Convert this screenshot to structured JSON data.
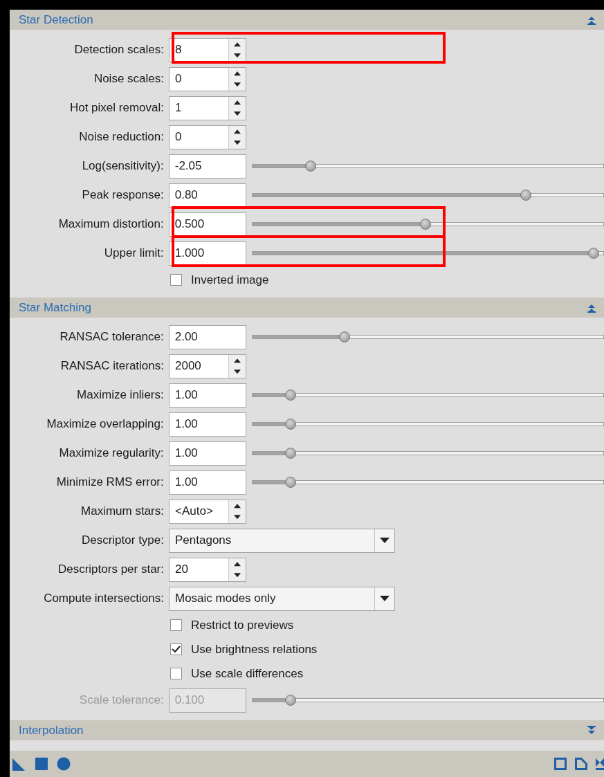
{
  "sections": [
    {
      "title": "Star Detection",
      "expanded": true,
      "rows": [
        {
          "kind": "spin",
          "label": "Detection scales:",
          "value": "8",
          "highlighted": true,
          "disabled": false
        },
        {
          "kind": "spin",
          "label": "Noise scales:",
          "value": "0",
          "highlighted": false,
          "disabled": false
        },
        {
          "kind": "spin",
          "label": "Hot pixel removal:",
          "value": "1",
          "highlighted": false,
          "disabled": false
        },
        {
          "kind": "spin",
          "label": "Noise reduction:",
          "value": "0",
          "highlighted": false,
          "disabled": false
        },
        {
          "kind": "slider",
          "label": "Log(sensitivity):",
          "value": "-2.05",
          "level": 0.16,
          "highlighted": false,
          "disabled": false
        },
        {
          "kind": "slider",
          "label": "Peak response:",
          "value": "0.80",
          "level": 0.8,
          "highlighted": false,
          "disabled": false
        },
        {
          "kind": "slider",
          "label": "Maximum distortion:",
          "value": "0.500",
          "level": 0.5,
          "highlighted": true,
          "disabled": false
        },
        {
          "kind": "slider",
          "label": "Upper limit:",
          "value": "1.000",
          "level": 1,
          "highlighted": true,
          "disabled": false
        },
        {
          "kind": "checkbox",
          "label": "Inverted image",
          "checked": false,
          "highlighted": false,
          "disabled": false
        }
      ]
    },
    {
      "title": "Star Matching",
      "expanded": true,
      "rows": [
        {
          "kind": "slider",
          "label": "RANSAC tolerance:",
          "value": "2.00",
          "level": 0.26,
          "highlighted": false,
          "disabled": false
        },
        {
          "kind": "spin",
          "label": "RANSAC iterations:",
          "value": "2000",
          "highlighted": false,
          "disabled": false
        },
        {
          "kind": "slider",
          "label": "Maximize inliers:",
          "value": "1.00",
          "level": 0.1,
          "highlighted": false,
          "disabled": false
        },
        {
          "kind": "slider",
          "label": "Maximize overlapping:",
          "value": "1.00",
          "level": 0.1,
          "highlighted": false,
          "disabled": false
        },
        {
          "kind": "slider",
          "label": "Maximize regularity:",
          "value": "1.00",
          "level": 0.1,
          "highlighted": false,
          "disabled": false
        },
        {
          "kind": "slider",
          "label": "Minimize RMS error:",
          "value": "1.00",
          "level": 0.1,
          "highlighted": false,
          "disabled": false
        },
        {
          "kind": "spin",
          "label": "Maximum stars:",
          "value": "<Auto>",
          "highlighted": false,
          "disabled": false
        },
        {
          "kind": "combo",
          "label": "Descriptor type:",
          "value": "Pentagons",
          "highlighted": false,
          "disabled": false
        },
        {
          "kind": "spin",
          "label": "Descriptors per star:",
          "value": "20",
          "highlighted": false,
          "disabled": false
        },
        {
          "kind": "combo",
          "label": "Compute intersections:",
          "value": "Mosaic modes only",
          "highlighted": false,
          "disabled": false
        },
        {
          "kind": "checkbox",
          "label": "Restrict to previews",
          "checked": false,
          "highlighted": false,
          "disabled": false
        },
        {
          "kind": "checkbox",
          "label": "Use brightness relations",
          "checked": true,
          "highlighted": false,
          "disabled": false
        },
        {
          "kind": "checkbox",
          "label": "Use scale differences",
          "checked": false,
          "highlighted": false,
          "disabled": false
        },
        {
          "kind": "slider",
          "label": "Scale tolerance:",
          "value": "0.100",
          "level": 0.1,
          "highlighted": false,
          "disabled": true
        }
      ]
    },
    {
      "title": "Interpolation",
      "expanded": false
    }
  ]
}
